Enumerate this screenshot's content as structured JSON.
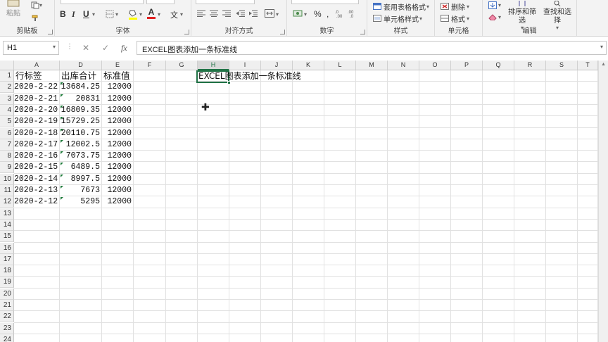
{
  "ribbon": {
    "clipboard": {
      "group_label": "剪贴板",
      "paste_label": "粘贴"
    },
    "font": {
      "group_label": "字体",
      "bold": "B",
      "italic": "I",
      "underline": "U",
      "font_color_glyph": "A",
      "wen_glyph": "文"
    },
    "alignment": {
      "group_label": "对齐方式"
    },
    "number": {
      "group_label": "数字",
      "percent": "%",
      "comma": ","
    },
    "styles": {
      "group_label": "样式",
      "table_format": "套用表格格式",
      "cell_styles": "单元格样式"
    },
    "cells": {
      "group_label": "单元格",
      "delete": "删除",
      "format": "格式"
    },
    "editing": {
      "group_label": "编辑",
      "sort_filter": "排序和筛选",
      "find_select": "查找和选择"
    }
  },
  "formula_bar": {
    "name_box": "H1",
    "cancel_glyph": "✕",
    "enter_glyph": "✓",
    "fx_glyph": "fx",
    "content": "EXCEL图表添加一条标准线"
  },
  "sheet": {
    "columns": [
      "A",
      "D",
      "E",
      "F",
      "G",
      "H",
      "I",
      "J",
      "K",
      "L",
      "M",
      "N",
      "O",
      "P",
      "Q",
      "R",
      "S",
      "T"
    ],
    "active_column": "H",
    "rows": [
      "1",
      "2",
      "3",
      "4",
      "5",
      "6",
      "7",
      "8",
      "9",
      "10",
      "11",
      "12",
      "13",
      "14",
      "15",
      "16",
      "17",
      "18",
      "19",
      "20",
      "21",
      "22",
      "23",
      "24"
    ],
    "headers": [
      "行标签",
      "出库合计",
      "标准值"
    ],
    "data": [
      [
        "2020-2-22",
        "13684.25",
        "12000"
      ],
      [
        "2020-2-21",
        "20831",
        "12000"
      ],
      [
        "2020-2-20",
        "16809.35",
        "12000"
      ],
      [
        "2020-2-19",
        "15729.25",
        "12000"
      ],
      [
        "2020-2-18",
        "20110.75",
        "12000"
      ],
      [
        "2020-2-17",
        "12002.5",
        "12000"
      ],
      [
        "2020-2-16",
        "7073.75",
        "12000"
      ],
      [
        "2020-2-15",
        "6489.5",
        "12000"
      ],
      [
        "2020-2-14",
        "8997.5",
        "12000"
      ],
      [
        "2020-2-13",
        "7673",
        "12000"
      ],
      [
        "2020-2-12",
        "5295",
        "12000"
      ]
    ],
    "h1_text": "EXCEL图表添加一条标准线",
    "accent_color": "#217346"
  }
}
